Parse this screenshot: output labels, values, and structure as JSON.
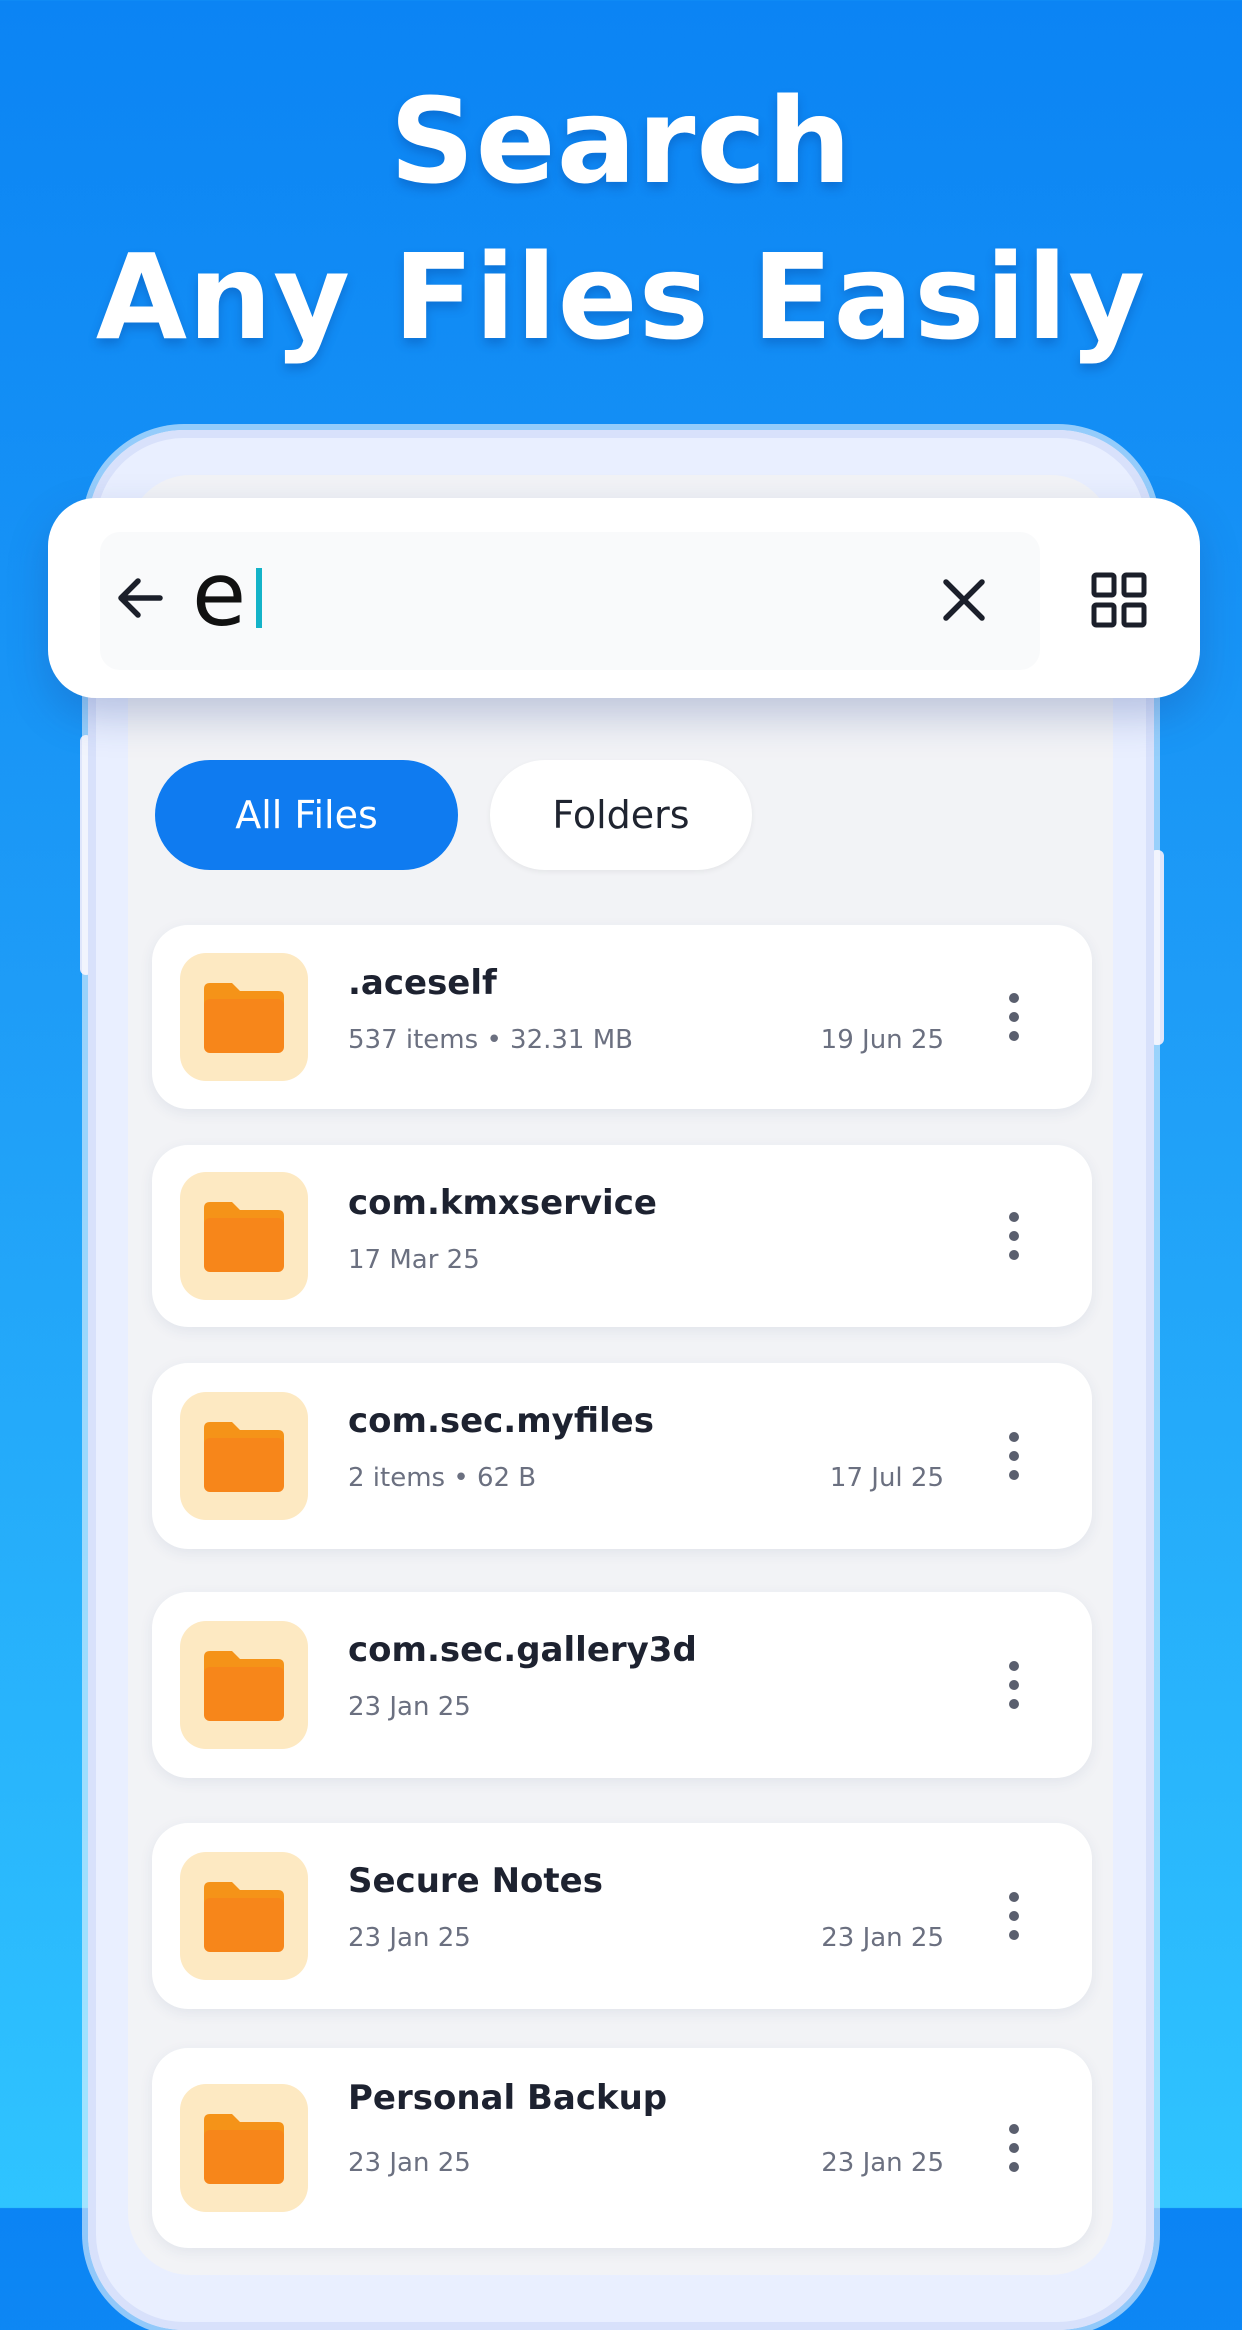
{
  "headline": {
    "line1": "Search",
    "line2": "Any Files Easily"
  },
  "search": {
    "query": "e",
    "back_icon": "arrow-left-icon",
    "clear_icon": "close-icon",
    "view_icon": "grid-view-icon"
  },
  "filters": {
    "all_files": "All Files",
    "folders": "Folders",
    "active": "All Files"
  },
  "files": [
    {
      "name": ".aceself",
      "meta": "537 items • 32.31 MB",
      "date": "19 Jun 25"
    },
    {
      "name": "com.kmxservice",
      "meta": "17 Mar 25",
      "date": ""
    },
    {
      "name": "com.sec.myfiles",
      "meta": "2 items • 62 B",
      "date": "17 Jul 25"
    },
    {
      "name": "com.sec.gallery3d",
      "meta": "23 Jan 25",
      "date": ""
    },
    {
      "name": "Secure Notes",
      "meta": "23 Jan 25",
      "date": "23 Jan 25"
    },
    {
      "name": "Personal Backup",
      "meta": "23 Jan 25",
      "date": "23 Jan 25"
    }
  ],
  "colors": {
    "accent": "#0f7bf0",
    "folder": "#f7861a",
    "folder_tile": "#fde9c2",
    "caret": "#14b3c8"
  }
}
